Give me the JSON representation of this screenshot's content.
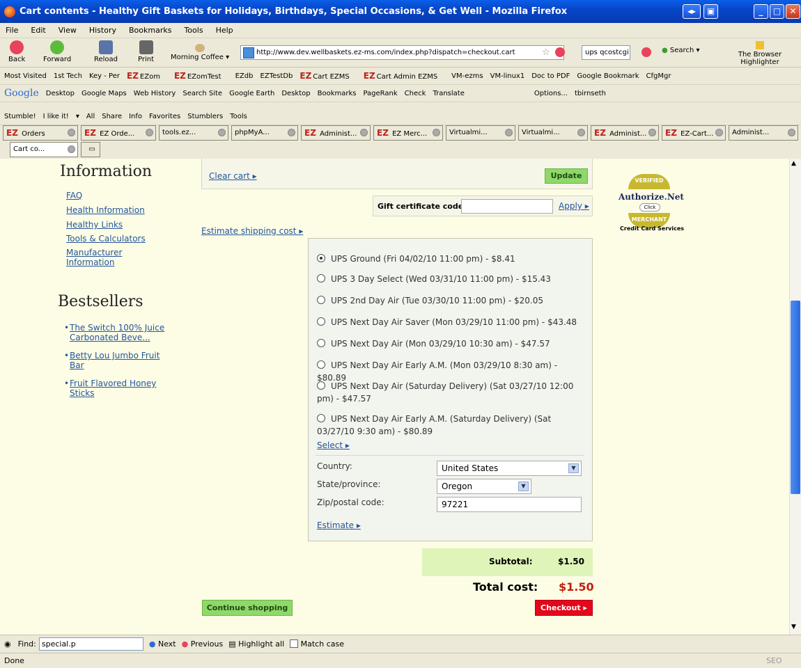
{
  "window": {
    "title": "Cart contents - Healthy Gift Baskets for Holidays, Birthdays, Special Occasions, & Get Well - Mozilla Firefox"
  },
  "menu": [
    "File",
    "Edit",
    "View",
    "History",
    "Bookmarks",
    "Tools",
    "Help"
  ],
  "nav": {
    "back": "Back",
    "forward": "Forward",
    "reload": "Reload",
    "print": "Print",
    "morning": "Morning Coffee",
    "url": "http://www.dev.wellbaskets.ez-ms.com/index.php?dispatch=checkout.cart",
    "search_value": "ups qcostcgi",
    "search_label": "Search",
    "highlighter": "The Browser Highlighter"
  },
  "bookmarks": [
    "Most Visited",
    "1st Tech",
    "Key - Per",
    "EZom",
    "EZomTest",
    "EZdb",
    "EZTestDb",
    "Cart EZMS",
    "Cart Admin EZMS",
    "VM-ezms",
    "VM-linux1",
    "Doc to PDF",
    "Google Bookmark",
    "CfgMgr"
  ],
  "google_toolbar": [
    "Desktop",
    "Google Maps",
    "Web History",
    "Search Site",
    "Google Earth",
    "Desktop",
    "Bookmarks",
    "PageRank",
    "Check",
    "Translate",
    "Options...",
    "tbirnseth"
  ],
  "stumble_toolbar": [
    "Stumble!",
    "I like it!",
    "All",
    "Share",
    "Info",
    "Favorites",
    "Stumblers",
    "Tools"
  ],
  "tabs_row1": [
    "Orders",
    "EZ Orde...",
    "tools.ez...",
    "phpMyA...",
    "Administ...",
    "EZ Merc...",
    "Virtualmi...",
    "Virtualmi...",
    "Administ...",
    "EZ-Cart...",
    "Administ..."
  ],
  "tabs_row2": [
    "Cart co..."
  ],
  "left": {
    "info_title": "Information",
    "info_links": [
      "FAQ",
      "Health Information",
      "Healthy Links",
      "Tools & Calculators",
      "Manufacturer Information"
    ],
    "best_title": "Bestsellers",
    "best_links": [
      "The Switch 100% Juice Carbonated Beve...",
      "Betty Lou Jumbo Fruit Bar",
      "Fruit Flavored Honey Sticks"
    ]
  },
  "cart": {
    "clear": "Clear cart",
    "update": "Update",
    "gift_label": "Gift certificate code:",
    "gift_value": "",
    "apply": "Apply",
    "estimate_link": "Estimate shipping cost",
    "shipping_options": [
      {
        "label": "UPS Ground (Fri 04/02/10 11:00 pm) - $8.41",
        "selected": true
      },
      {
        "label": "UPS 3 Day Select (Wed 03/31/10 11:00 pm) - $15.43",
        "selected": false
      },
      {
        "label": "UPS 2nd Day Air (Tue 03/30/10 11:00 pm) - $20.05",
        "selected": false
      },
      {
        "label": "UPS Next Day Air Saver (Mon 03/29/10 11:00 pm) - $43.48",
        "selected": false
      },
      {
        "label": "UPS Next Day Air (Mon 03/29/10 10:30 am) - $47.57",
        "selected": false
      },
      {
        "label": "UPS Next Day Air Early A.M. (Mon 03/29/10 8:30 am) - $80.89",
        "selected": false
      },
      {
        "label": "UPS Next Day Air (Saturday Delivery) (Sat 03/27/10 12:00 pm) - $47.57",
        "selected": false
      },
      {
        "label": "UPS Next Day Air Early A.M. (Saturday Delivery) (Sat 03/27/10 9:30 am) - $80.89",
        "selected": false
      }
    ],
    "select": "Select",
    "country_label": "Country:",
    "country_value": "United States",
    "state_label": "State/province:",
    "state_value": "Oregon",
    "zip_label": "Zip/postal code:",
    "zip_value": "97221",
    "estimate": "Estimate",
    "subtotal_label": "Subtotal:",
    "subtotal_value": "$1.50",
    "total_label": "Total cost:",
    "total_value": "$1.50",
    "continue": "Continue shopping",
    "checkout": "Checkout"
  },
  "badge": {
    "top": "VERIFIED",
    "name": "Authorize.Net",
    "click": "Click",
    "bottom": "MERCHANT",
    "caption": "Credit Card Services"
  },
  "find": {
    "label": "Find:",
    "value": "special.p",
    "next": "Next",
    "previous": "Previous",
    "highlight": "Highlight all",
    "matchcase": "Match case"
  },
  "status": {
    "text": "Done",
    "seo": "SEO"
  },
  "colors": {
    "page_bg": "#fdfde6",
    "link": "#23559b",
    "green_btn": "#8fd86a",
    "red_btn": "#e3071b",
    "total": "#c0200f"
  }
}
